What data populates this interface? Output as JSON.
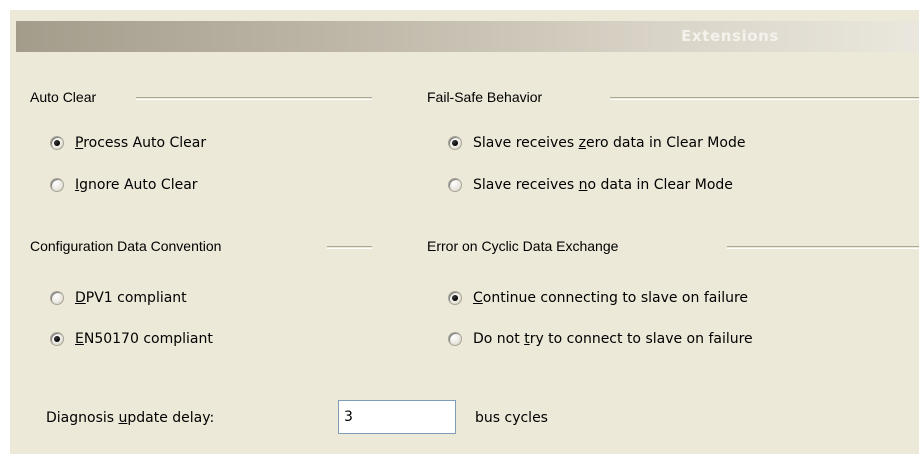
{
  "header": {
    "title": "Extensions"
  },
  "auto_clear": {
    "title": "Auto Clear",
    "options": [
      {
        "pre": "",
        "acc": "P",
        "post": "rocess Auto Clear",
        "selected": true
      },
      {
        "pre": "",
        "acc": "I",
        "post": "gnore Auto Clear",
        "selected": false
      }
    ]
  },
  "fail_safe": {
    "title": "Fail-Safe Behavior",
    "options": [
      {
        "pre": "Slave receives ",
        "acc": "z",
        "post": "ero data in Clear Mode",
        "selected": true
      },
      {
        "pre": "Slave receives ",
        "acc": "n",
        "post": "o data in Clear Mode",
        "selected": false
      }
    ]
  },
  "config_convention": {
    "title": "Configuration Data Convention",
    "options": [
      {
        "pre": "",
        "acc": "D",
        "post": "PV1 compliant",
        "selected": false
      },
      {
        "pre": "",
        "acc": "E",
        "post": "N50170 compliant",
        "selected": true
      }
    ]
  },
  "cyclic_error": {
    "title": "Error on Cyclic Data Exchange",
    "options": [
      {
        "pre": "",
        "acc": "C",
        "post": "ontinue connecting to slave on failure",
        "selected": true
      },
      {
        "pre": "Do not ",
        "acc": "t",
        "post": "ry to connect to slave on failure",
        "selected": false
      }
    ]
  },
  "diagnosis": {
    "label_pre": "Diagnosis ",
    "label_acc": "u",
    "label_post": "pdate delay:",
    "value": "3",
    "unit": "bus cycles"
  }
}
